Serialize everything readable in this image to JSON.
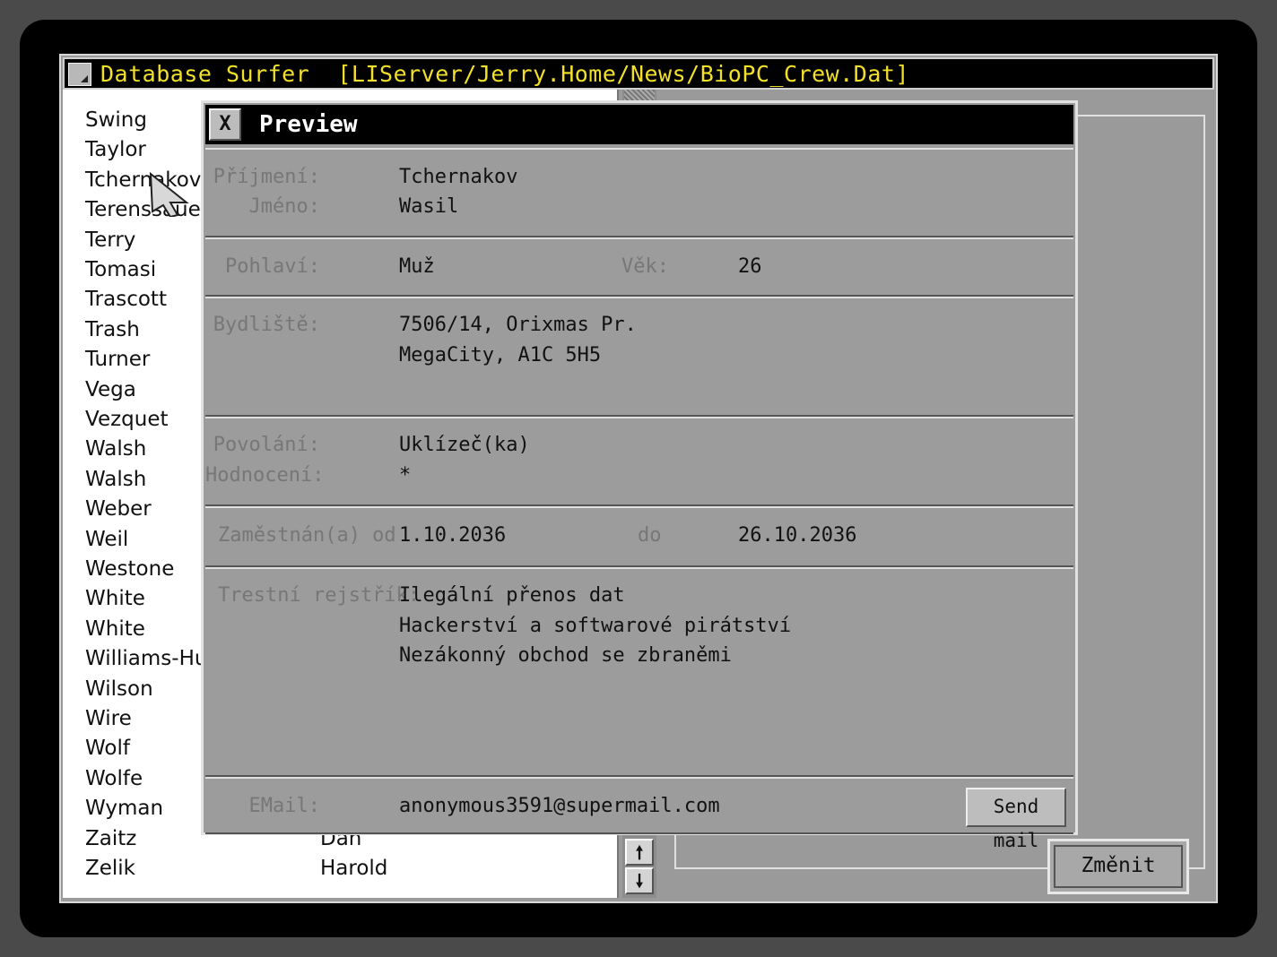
{
  "window": {
    "title": "Database Surfer  [LIServer/Jerry.Home/News/BioPC_Crew.Dat]"
  },
  "list": {
    "rows": [
      {
        "last": "Swing"
      },
      {
        "last": "Taylor"
      },
      {
        "last": "Tchernakov"
      },
      {
        "last": "Terenssauer"
      },
      {
        "last": "Terry"
      },
      {
        "last": "Tomasi"
      },
      {
        "last": "Trascott"
      },
      {
        "last": "Trash"
      },
      {
        "last": "Turner"
      },
      {
        "last": "Vega"
      },
      {
        "last": "Vezquet"
      },
      {
        "last": "Walsh"
      },
      {
        "last": "Walsh"
      },
      {
        "last": "Weber"
      },
      {
        "last": "Weil"
      },
      {
        "last": "Westone"
      },
      {
        "last": "White"
      },
      {
        "last": "White"
      },
      {
        "last": "Williams-Hurr"
      },
      {
        "last": "Wilson"
      },
      {
        "last": "Wire"
      },
      {
        "last": "Wolf"
      },
      {
        "last": "Wolfe"
      },
      {
        "last": "Wyman"
      },
      {
        "last": "Zaitz",
        "first": "Dan"
      },
      {
        "last": "Zelik",
        "first": "Harold"
      }
    ]
  },
  "scrollbar": {
    "up_icon": "arrow-up-icon",
    "down_icon": "arrow-down-icon",
    "up_glyph": "🠕",
    "down_glyph": "🠗"
  },
  "zmenit_label": "Změnit",
  "preview": {
    "close_label": "X",
    "title": "Preview",
    "surname_label": "Příjmení:",
    "surname": "Tchernakov",
    "name_label": "Jméno:",
    "name": "Wasil",
    "sex_label": "Pohlaví:",
    "sex": "Muž",
    "age_label": "Věk:",
    "age": "26",
    "address_label": "Bydliště:",
    "address_line1": "7506/14, Orixmas Pr.",
    "address_line2": "MegaCity, A1C 5H5",
    "job_label": "Povolání:",
    "job": "Uklízeč(ka)",
    "rating_label": "Hodnocení:",
    "rating": "*",
    "employed_label": "Zaměstnán(a) od",
    "employed_from": "1.10.2036",
    "to_label": "do",
    "employed_to": "26.10.2036",
    "record_label": "Trestní rejstřík:",
    "record": [
      "Ilegální přenos dat",
      "Hackerství a softwarové pirátství",
      "Nezákonný obchod se zbraněmi"
    ],
    "email_label": "EMail:",
    "email": "anonymous3591@supermail.com",
    "send_mail_label": "Send mail"
  }
}
